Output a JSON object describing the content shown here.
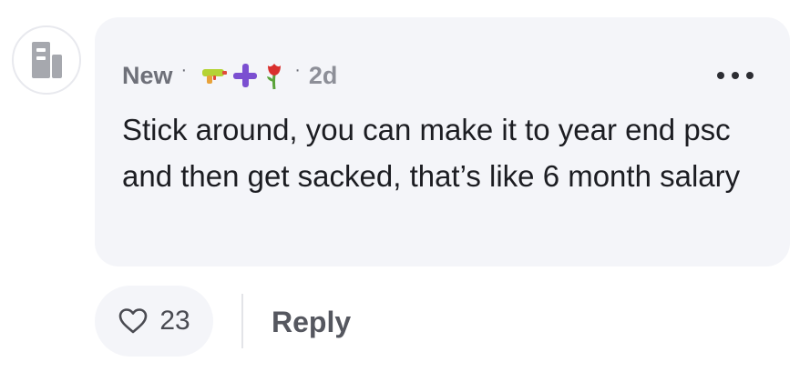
{
  "comment": {
    "avatar_icon": "building-icon",
    "author": "New",
    "separator": "·",
    "flair_icons": [
      "water-gun-icon",
      "plus-icon",
      "rose-icon"
    ],
    "time": "2d",
    "more_icon": "ellipsis-icon",
    "body": "Stick around, you can make it to year end psc and then get sacked, that’s like 6 month salary"
  },
  "actions": {
    "like_icon": "heart-icon",
    "like_count": "23",
    "reply_label": "Reply"
  },
  "colors": {
    "bubble": "#f4f5f9",
    "text": "#1c1d22",
    "muted": "#6e7079",
    "flair_purple": "#7b4fd1"
  }
}
